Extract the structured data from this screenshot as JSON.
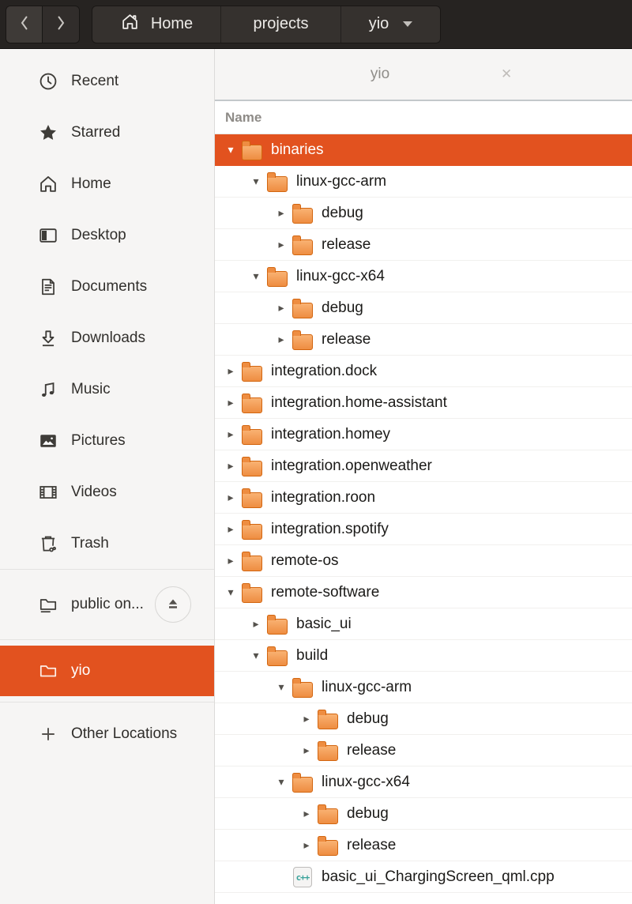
{
  "header": {
    "back_tooltip": "Back",
    "forward_tooltip": "Forward",
    "breadcrumbs": [
      {
        "label": "Home",
        "icon": "home"
      },
      {
        "label": "projects"
      },
      {
        "label": "yio",
        "has_menu_caret": true
      }
    ]
  },
  "tab": {
    "title": "yio",
    "close_glyph": "✕"
  },
  "columns": {
    "name": "Name"
  },
  "sidebar": {
    "items": [
      {
        "icon": "clock",
        "label": "Recent"
      },
      {
        "icon": "star",
        "label": "Starred"
      },
      {
        "icon": "home",
        "label": "Home"
      },
      {
        "icon": "desktop",
        "label": "Desktop"
      },
      {
        "icon": "documents",
        "label": "Documents"
      },
      {
        "icon": "downloads",
        "label": "Downloads"
      },
      {
        "icon": "music",
        "label": "Music"
      },
      {
        "icon": "pictures",
        "label": "Pictures"
      },
      {
        "icon": "videos",
        "label": "Videos"
      },
      {
        "icon": "trash",
        "label": "Trash"
      }
    ],
    "drive": {
      "label": "public on...",
      "icon": "folder-remote",
      "eject_icon": "eject"
    },
    "selected": {
      "label": "yio",
      "icon": "folder"
    },
    "other": {
      "label": "Other Locations",
      "icon": "plus"
    }
  },
  "tree": {
    "cpp_badge": "c++",
    "rows": [
      {
        "label": "binaries",
        "level": 0,
        "expander": "expanded",
        "icon": "folder",
        "selected": true
      },
      {
        "label": "linux-gcc-arm",
        "level": 1,
        "expander": "expanded",
        "icon": "folder"
      },
      {
        "label": "debug",
        "level": 2,
        "expander": "collapsed",
        "icon": "folder"
      },
      {
        "label": "release",
        "level": 2,
        "expander": "collapsed",
        "icon": "folder"
      },
      {
        "label": "linux-gcc-x64",
        "level": 1,
        "expander": "expanded",
        "icon": "folder"
      },
      {
        "label": "debug",
        "level": 2,
        "expander": "collapsed",
        "icon": "folder"
      },
      {
        "label": "release",
        "level": 2,
        "expander": "collapsed",
        "icon": "folder"
      },
      {
        "label": "integration.dock",
        "level": 0,
        "expander": "collapsed",
        "icon": "folder"
      },
      {
        "label": "integration.home-assistant",
        "level": 0,
        "expander": "collapsed",
        "icon": "folder"
      },
      {
        "label": "integration.homey",
        "level": 0,
        "expander": "collapsed",
        "icon": "folder"
      },
      {
        "label": "integration.openweather",
        "level": 0,
        "expander": "collapsed",
        "icon": "folder"
      },
      {
        "label": "integration.roon",
        "level": 0,
        "expander": "collapsed",
        "icon": "folder"
      },
      {
        "label": "integration.spotify",
        "level": 0,
        "expander": "collapsed",
        "icon": "folder"
      },
      {
        "label": "remote-os",
        "level": 0,
        "expander": "collapsed",
        "icon": "folder"
      },
      {
        "label": "remote-software",
        "level": 0,
        "expander": "expanded",
        "icon": "folder"
      },
      {
        "label": "basic_ui",
        "level": 1,
        "expander": "collapsed",
        "icon": "folder"
      },
      {
        "label": "build",
        "level": 1,
        "expander": "expanded",
        "icon": "folder"
      },
      {
        "label": "linux-gcc-arm",
        "level": 2,
        "expander": "expanded",
        "icon": "folder"
      },
      {
        "label": "debug",
        "level": 3,
        "expander": "collapsed",
        "icon": "folder"
      },
      {
        "label": "release",
        "level": 3,
        "expander": "collapsed",
        "icon": "folder"
      },
      {
        "label": "linux-gcc-x64",
        "level": 2,
        "expander": "expanded",
        "icon": "folder"
      },
      {
        "label": "debug",
        "level": 3,
        "expander": "collapsed",
        "icon": "folder"
      },
      {
        "label": "release",
        "level": 3,
        "expander": "collapsed",
        "icon": "folder"
      },
      {
        "label": "basic_ui_ChargingScreen_qml.cpp",
        "level": 2,
        "expander": "none",
        "icon": "cpp"
      }
    ]
  },
  "colors": {
    "selection_orange": "#E2521F",
    "folder_orange": "#EE8D41",
    "folder_outline": "#D2650F",
    "headerbar_bg": "#262321",
    "sidebar_bg": "#F6F5F4",
    "cpp_badge_teal": "#3AA39B"
  }
}
